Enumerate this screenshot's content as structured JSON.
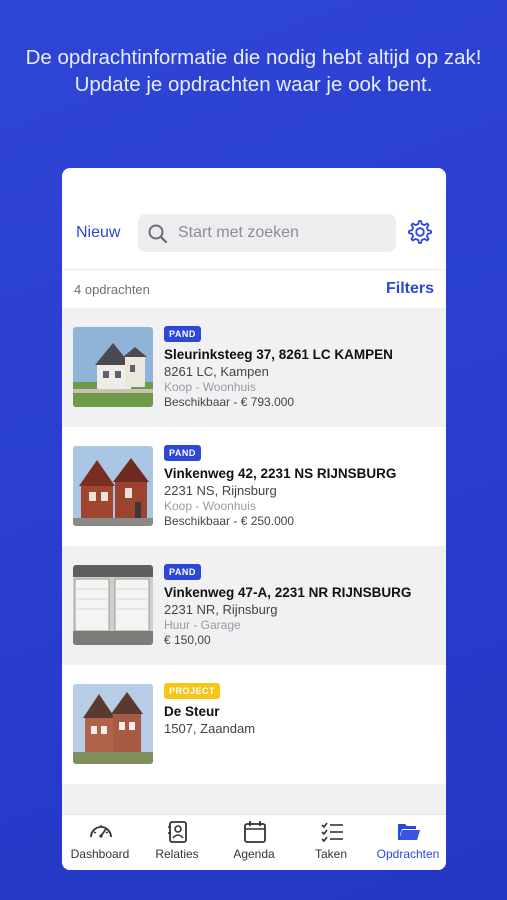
{
  "headline": "De opdrachtinformatie die nodig hebt altijd op zak! Update je opdrachten waar je ook bent.",
  "topbar": {
    "new_label": "Nieuw",
    "search_placeholder": "Start met zoeken"
  },
  "list_header": {
    "count": "4 opdrachten",
    "filters_label": "Filters"
  },
  "items": [
    {
      "badge": "PAND",
      "title": "Sleurinksteeg 37, 8261 LC KAMPEN",
      "line2": "8261 LC, Kampen",
      "line3": "Koop - Woonhuis",
      "line4": "Beschikbaar - € 793.000"
    },
    {
      "badge": "PAND",
      "title": "Vinkenweg 42, 2231 NS RIJNSBURG",
      "line2": "2231 NS, Rijnsburg",
      "line3": "Koop - Woonhuis",
      "line4": "Beschikbaar - € 250.000"
    },
    {
      "badge": "PAND",
      "title": "Vinkenweg 47-A, 2231 NR RIJNSBURG",
      "line2": "2231 NR, Rijnsburg",
      "line3": "Huur - Garage",
      "line4": "€ 150,00"
    },
    {
      "badge": "PROJECT",
      "title": "De Steur",
      "line2": "1507, Zaandam",
      "line3": "",
      "line4": ""
    }
  ],
  "tabs": [
    {
      "label": "Dashboard",
      "icon": "speedometer-icon"
    },
    {
      "label": "Relaties",
      "icon": "contact-card-icon"
    },
    {
      "label": "Agenda",
      "icon": "calendar-icon"
    },
    {
      "label": "Taken",
      "icon": "checklist-icon"
    },
    {
      "label": "Opdrachten",
      "icon": "folder-icon",
      "active": true
    }
  ],
  "colors": {
    "accent": "#2d47d6",
    "background": "#2a3fd0",
    "project_badge": "#f5c518"
  }
}
